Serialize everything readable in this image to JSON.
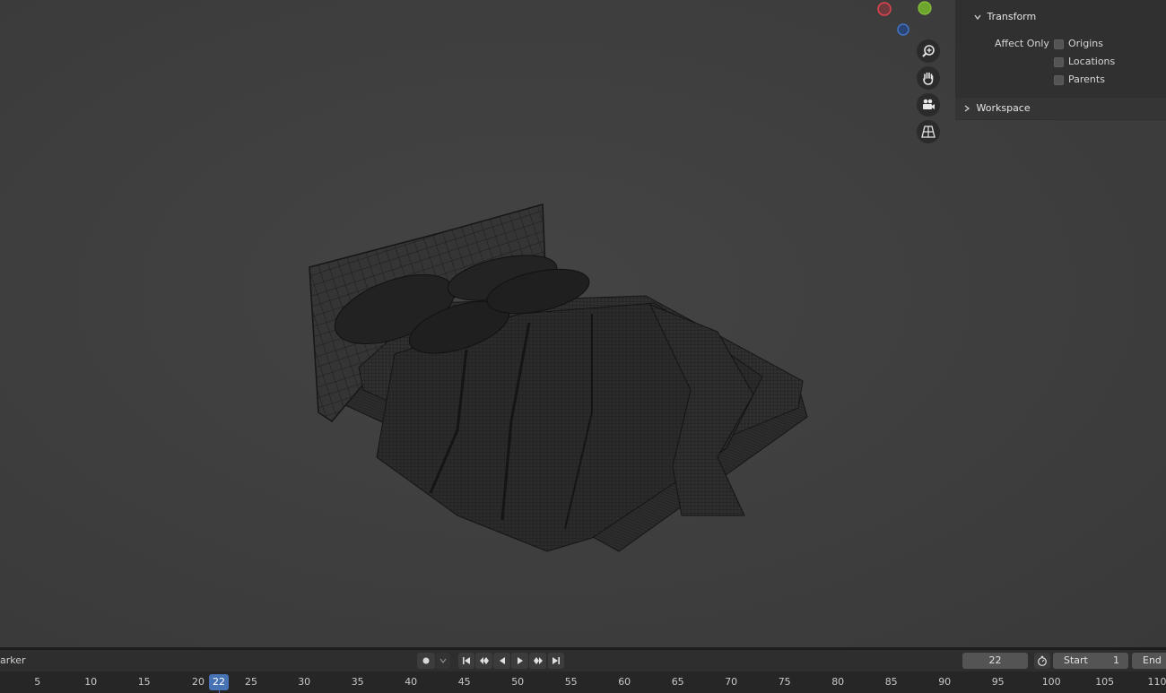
{
  "sidebar": {
    "transform": {
      "label": "Transform",
      "expanded": true
    },
    "affect_only_label": "Affect Only",
    "options": [
      {
        "label": "Origins",
        "checked": false
      },
      {
        "label": "Locations",
        "checked": false
      },
      {
        "label": "Parents",
        "checked": false
      }
    ],
    "workspace": {
      "label": "Workspace",
      "expanded": false
    }
  },
  "nav_tools": [
    "zoom-icon",
    "pan-hand-icon",
    "camera-icon",
    "perspective-grid-icon"
  ],
  "gizmo_colors": {
    "x": "#e0454f",
    "y": "#6ea52c",
    "z": "#3f74c5"
  },
  "timeline": {
    "marker_label": "arker",
    "current_frame": "22",
    "start_label": "Start",
    "start_value": "1",
    "end_label": "End",
    "ruler_ticks": [
      "5",
      "10",
      "15",
      "20",
      "25",
      "30",
      "35",
      "40",
      "45",
      "50",
      "55",
      "60",
      "65",
      "70",
      "75",
      "80",
      "85",
      "90",
      "95",
      "100",
      "105",
      "110"
    ],
    "highlight_frame": "22"
  },
  "colors": {
    "accent": "#4772b3",
    "viewport_bg": "#3d3d3d"
  }
}
